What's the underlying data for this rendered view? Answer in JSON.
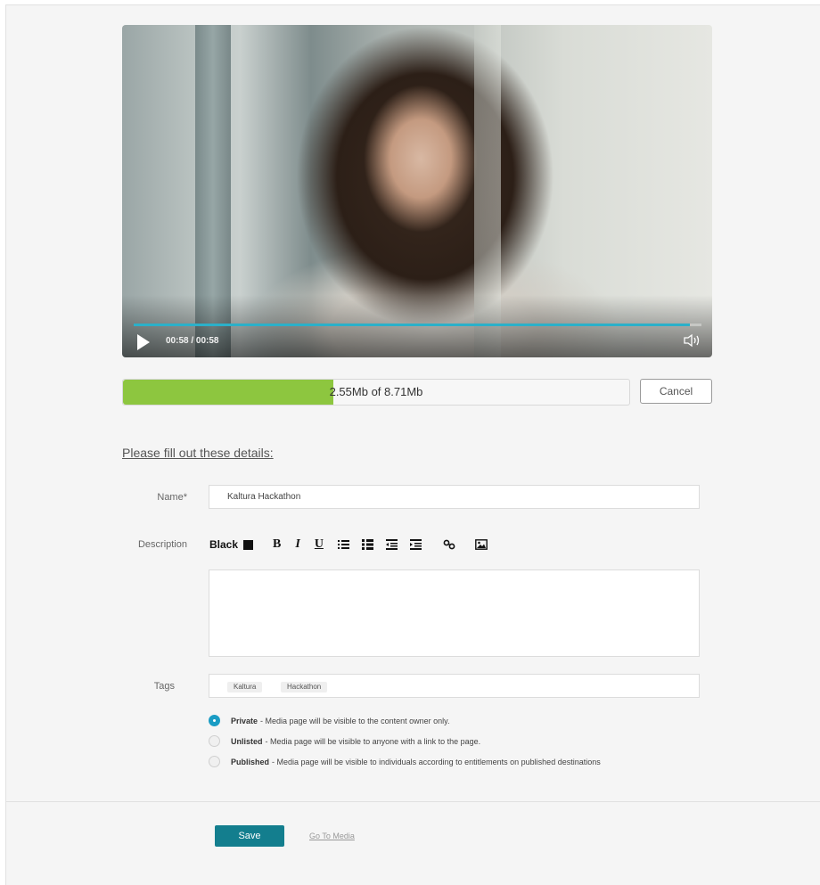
{
  "player": {
    "time": "00:58 / 00:58",
    "progress_fraction": 0.98,
    "colors": {
      "accent": "#2bb0c9"
    }
  },
  "upload": {
    "status_text": "2.55Mb of 8.71Mb",
    "progress_fraction": 0.415,
    "cancel_label": "Cancel",
    "colors": {
      "fill": "#8dc63f"
    }
  },
  "form": {
    "title": "Please fill out these details:",
    "name_label": "Name*",
    "name_value": "Kaltura Hackathon",
    "description_label": "Description",
    "toolbar": {
      "color_label": "Black",
      "bold": "B",
      "italic": "I",
      "underline": "U",
      "icons": [
        "ordered-list-icon",
        "bullet-list-icon",
        "outdent-icon",
        "indent-icon",
        "link-icon",
        "image-icon"
      ]
    },
    "description_value": "",
    "tags_label": "Tags",
    "tags": [
      "Kaltura",
      "Hackathon"
    ],
    "visibility": [
      {
        "title": "Private",
        "desc": " - Media page will be visible to the content owner only.",
        "checked": true
      },
      {
        "title": "Unlisted",
        "desc": " - Media page will be visible to anyone with a link to the page.",
        "checked": false
      },
      {
        "title": "Published",
        "desc": " - Media page will be visible to individuals according to entitlements on published destinations",
        "checked": false
      }
    ]
  },
  "footer": {
    "save_label": "Save",
    "goto_label": "Go To Media",
    "colors": {
      "save": "#137e8e"
    }
  }
}
